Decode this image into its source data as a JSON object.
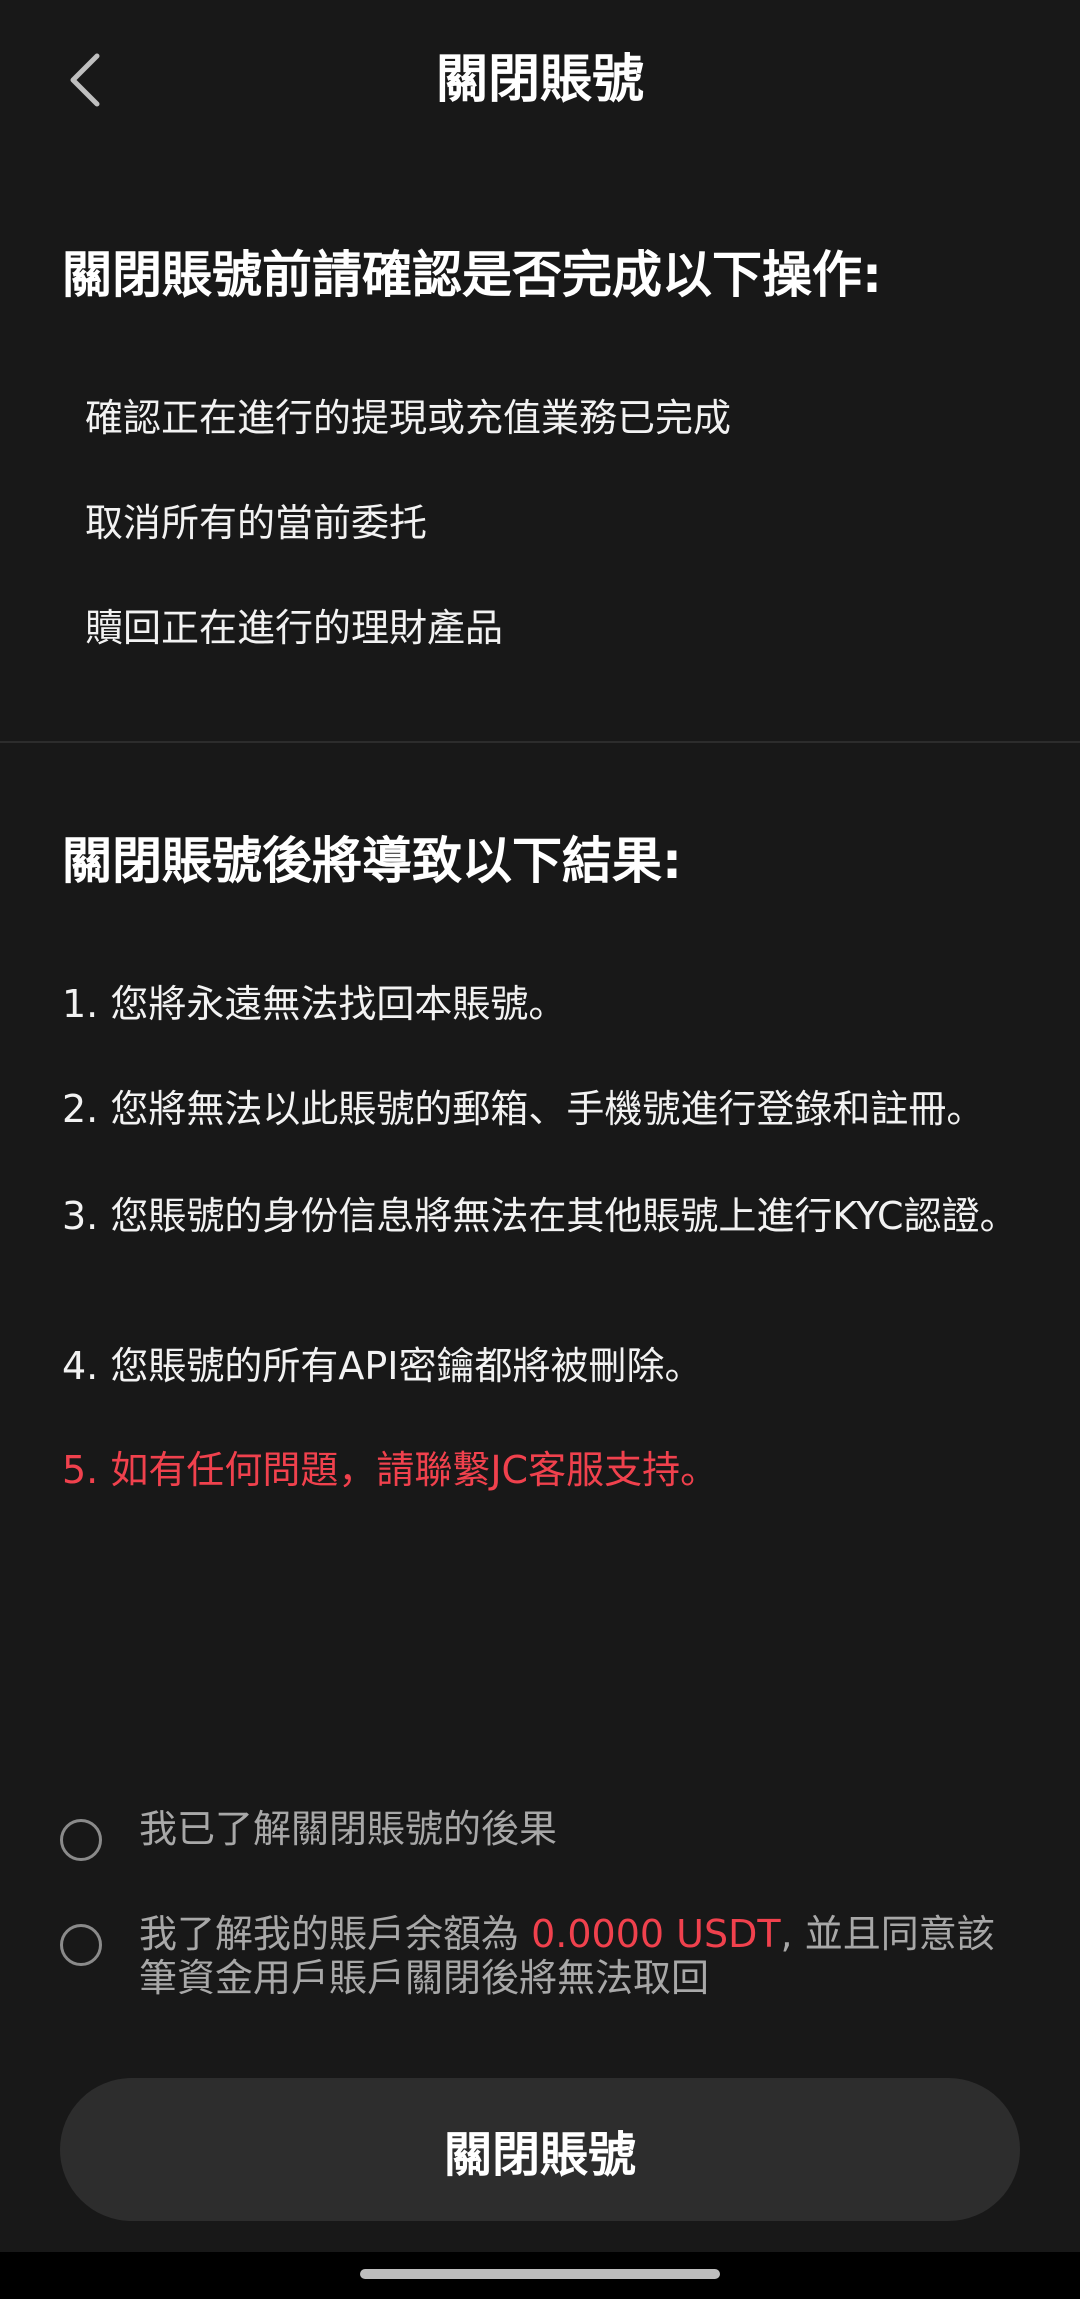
{
  "header": {
    "title": "關閉賬號",
    "back_icon": "chevron-left-icon"
  },
  "pre_checks": {
    "title": "關閉賬號前請確認是否完成以下操作:",
    "items": [
      "確認正在進行的提現或充值業務已完成",
      "取消所有的當前委托",
      "贖回正在進行的理財產品"
    ]
  },
  "consequences": {
    "title": "關閉賬號後將導致以下結果:",
    "items": [
      "1. 您將永遠無法找回本賬號。",
      "2. 您將無法以此賬號的郵箱、手機號進行登錄和註冊。",
      "3. 您賬號的身份信息將無法在其他賬號上進行KYC認證。",
      "4. 您賬號的所有API密鑰都將被刪除。",
      "5. 如有任何問題，請聯繫JC客服支持。"
    ]
  },
  "agreements": {
    "understand_label": "我已了解關閉賬號的後果",
    "balance_prefix": "我了解我的賬戶余額為 ",
    "balance_amount": "0.0000 USDT",
    "balance_suffix": ", 並且同意該筆資金用戶賬戶關閉後將無法取回"
  },
  "actions": {
    "close_button_label": "關閉賬號"
  },
  "colors": {
    "background": "#181818",
    "warning_red": "#f0414d",
    "button_bg": "#2d2d2d"
  }
}
